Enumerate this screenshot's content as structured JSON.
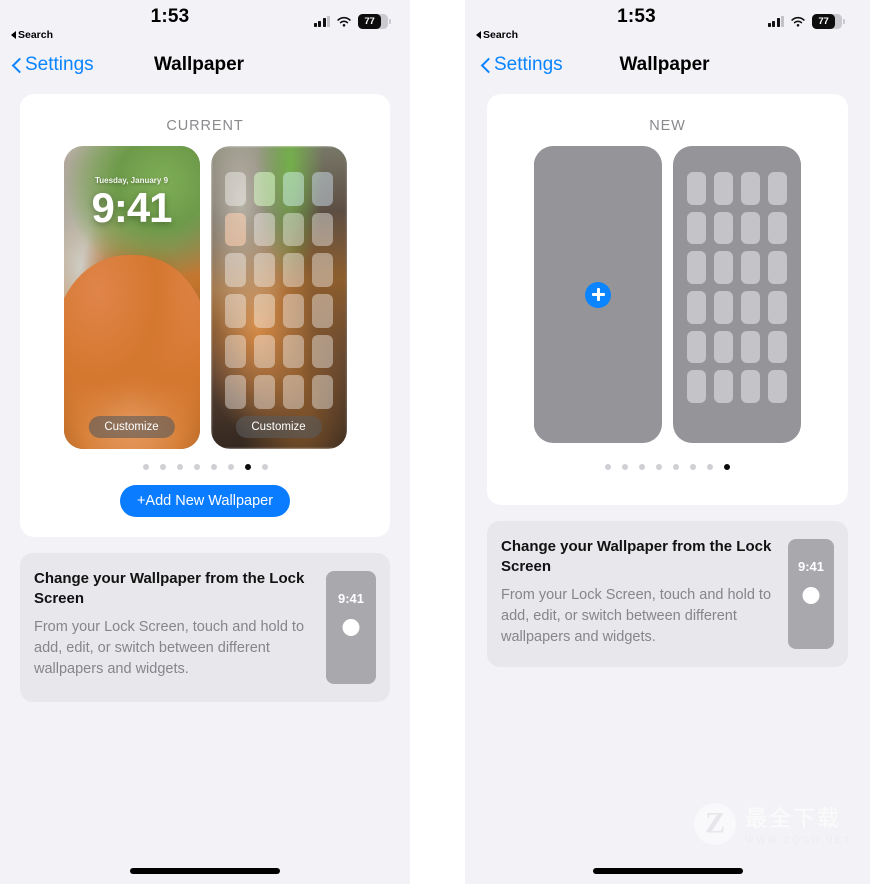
{
  "panels": [
    {
      "id": "left",
      "status": {
        "time": "1:53",
        "back_label": "Search",
        "battery": "77",
        "wifi_icon": "wifi-icon",
        "signal_icon": "cellular-signal-icon"
      },
      "nav": {
        "back_label": "Settings",
        "title": "Wallpaper"
      },
      "card": {
        "section_label": "CURRENT",
        "lock_preview": {
          "date": "Tuesday, January 9",
          "time": "9:41",
          "customize_label": "Customize"
        },
        "home_preview": {
          "customize_label": "Customize"
        },
        "dots_count": 8,
        "active_dot": 7,
        "add_button_label": "+Add New Wallpaper"
      },
      "info": {
        "title": "Change your Wallpaper from the Lock Screen",
        "body": "From your Lock Screen, touch and hold to add, edit, or switch between different wallpapers and widgets.",
        "mini_time": "9:41"
      }
    },
    {
      "id": "right",
      "status": {
        "time": "1:53",
        "back_label": "Search",
        "battery": "77",
        "wifi_icon": "wifi-icon",
        "signal_icon": "cellular-signal-icon"
      },
      "nav": {
        "back_label": "Settings",
        "title": "Wallpaper"
      },
      "card": {
        "section_label": "NEW",
        "lock_preview": {
          "date": "",
          "time": "",
          "customize_label": ""
        },
        "home_preview": {
          "customize_label": ""
        },
        "dots_count": 8,
        "active_dot": 8,
        "add_button_label": ""
      },
      "info": {
        "title": "Change your Wallpaper from the Lock Screen",
        "body": "From your Lock Screen, touch and hold to add, edit, or switch between different wallpapers and widgets.",
        "mini_time": "9:41"
      }
    }
  ],
  "watermark": {
    "logo_letter": "Z",
    "text": "最全下载",
    "url": "WWW.ZQGD.NET"
  },
  "colors": {
    "accent": "#0a84ff",
    "add_button": "#0a7cff",
    "card_bg": "#ffffff",
    "page_bg": "#f2f2f7",
    "info_bg": "#e7e7ec",
    "placeholder_gray": "#949499"
  }
}
